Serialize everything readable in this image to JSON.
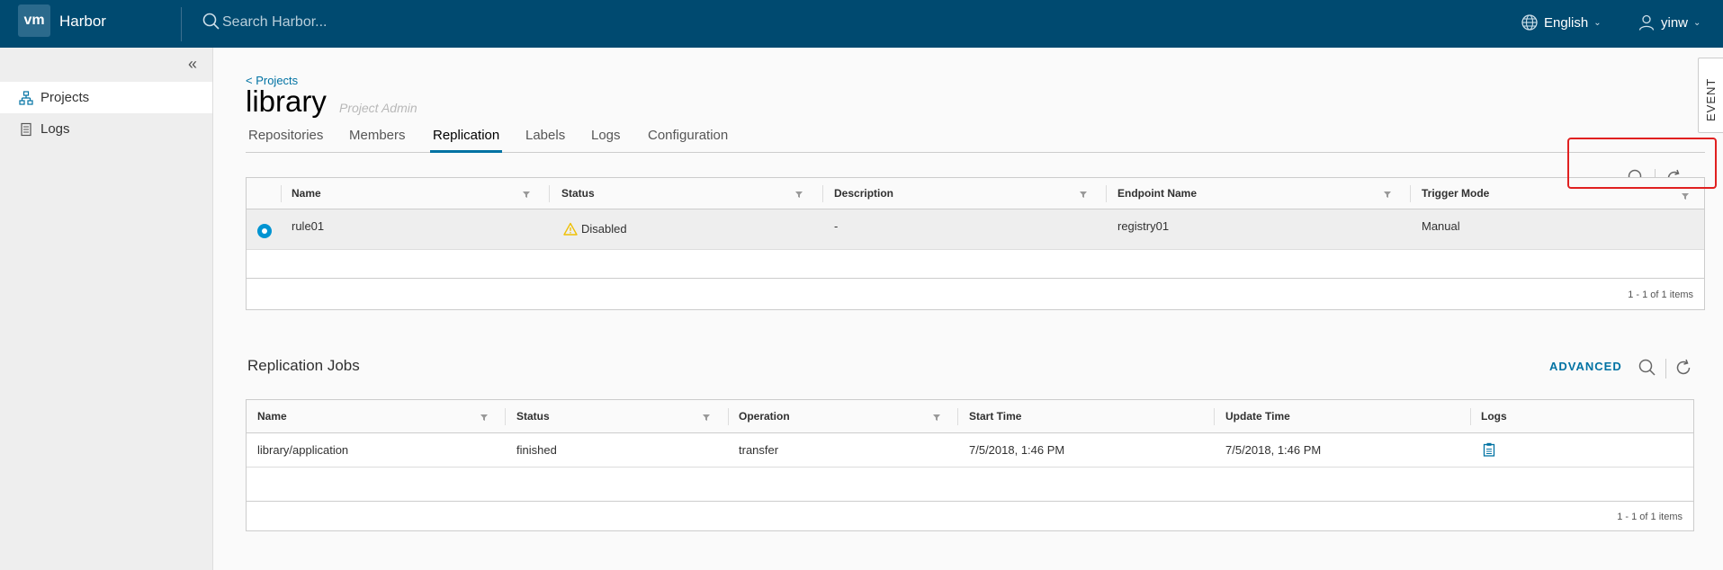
{
  "header": {
    "logo": "vm",
    "brand": "Harbor",
    "search_placeholder": "Search Harbor...",
    "language": "English",
    "user": "yinw"
  },
  "sidebar": {
    "items": [
      {
        "label": "Projects",
        "icon": "projects-icon",
        "active": true
      },
      {
        "label": "Logs",
        "icon": "logs-icon",
        "active": false
      }
    ]
  },
  "project": {
    "breadcrumb": "< Projects",
    "name": "library",
    "role": "Project Admin"
  },
  "tabs": [
    "Repositories",
    "Members",
    "Replication",
    "Labels",
    "Logs",
    "Configuration"
  ],
  "active_tab": "Replication",
  "rules_grid": {
    "columns": [
      "Name",
      "Status",
      "Description",
      "Endpoint Name",
      "Trigger Mode"
    ],
    "rows": [
      {
        "name": "rule01",
        "status": "Disabled",
        "description": "-",
        "endpoint": "registry01",
        "trigger": "Manual",
        "selected": true
      }
    ],
    "footer": "1 - 1 of 1 items"
  },
  "event_tab": "EVENT",
  "jobs": {
    "title": "Replication Jobs",
    "advanced": "ADVANCED",
    "columns": [
      "Name",
      "Status",
      "Operation",
      "Start Time",
      "Update Time",
      "Logs"
    ],
    "rows": [
      {
        "name": "library/application",
        "status": "finished",
        "operation": "transfer",
        "start": "7/5/2018, 1:46 PM",
        "update": "7/5/2018, 1:46 PM"
      }
    ],
    "footer": "1 - 1 of 1 items"
  },
  "colors": {
    "header": "#004a70",
    "accent": "#0072a3",
    "warning": "#efc006",
    "highlight": "#e02020"
  }
}
